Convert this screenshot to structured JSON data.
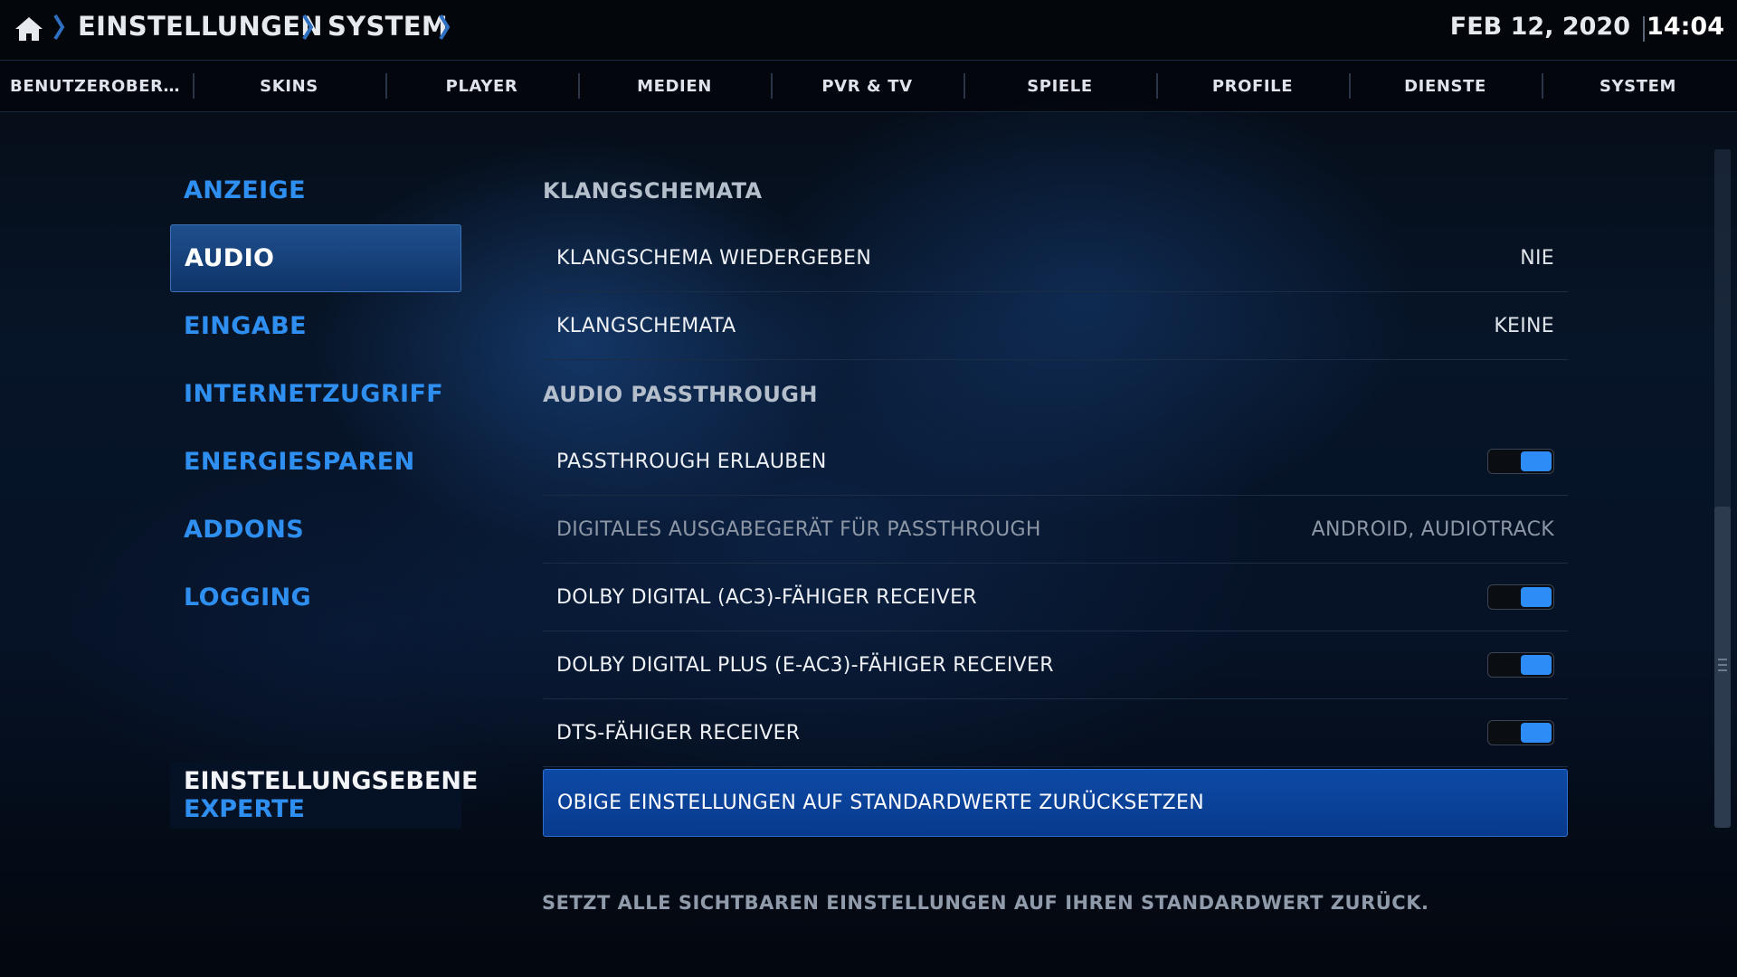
{
  "header": {
    "breadcrumbs": [
      "EINSTELLUNGEN",
      "SYSTEM"
    ],
    "date": "FEB 12, 2020",
    "time": "14:04"
  },
  "tabs": [
    "BENUTZEROBER…",
    "SKINS",
    "PLAYER",
    "MEDIEN",
    "PVR & TV",
    "SPIELE",
    "PROFILE",
    "DIENSTE",
    "SYSTEM"
  ],
  "sidebar": {
    "items": [
      {
        "label": "ANZEIGE"
      },
      {
        "label": "AUDIO",
        "active": true
      },
      {
        "label": "EINGABE"
      },
      {
        "label": "INTERNETZUGRIFF"
      },
      {
        "label": "ENERGIESPAREN"
      },
      {
        "label": "ADDONS"
      },
      {
        "label": "LOGGING"
      }
    ],
    "level_title": "EINSTELLUNGSEBENE",
    "level_value": "EXPERTE"
  },
  "main": {
    "group1": "KLANGSCHEMATA",
    "row1_label": "KLANGSCHEMA WIEDERGEBEN",
    "row1_value": "NIE",
    "row2_label": "KLANGSCHEMATA",
    "row2_value": "KEINE",
    "group2": "AUDIO PASSTHROUGH",
    "row3_label": "PASSTHROUGH ERLAUBEN",
    "row4_label": "DIGITALES AUSGABEGERÄT FÜR PASSTHROUGH",
    "row4_value": "ANDROID, AUDIOTRACK",
    "row5_label": "DOLBY DIGITAL (AC3)-FÄHIGER RECEIVER",
    "row6_label": "DOLBY DIGITAL PLUS (E-AC3)-FÄHIGER RECEIVER",
    "row7_label": "DTS-FÄHIGER RECEIVER",
    "reset_label": "OBIGE EINSTELLUNGEN AUF STANDARDWERTE ZURÜCKSETZEN"
  },
  "description": "SETZT ALLE SICHTBAREN EINSTELLUNGEN AUF IHREN STANDARDWERT ZURÜCK.",
  "colors": {
    "accent": "#2f8ff0",
    "focus": "#0d4aa6",
    "toggle_on": "#2d8cf5"
  }
}
